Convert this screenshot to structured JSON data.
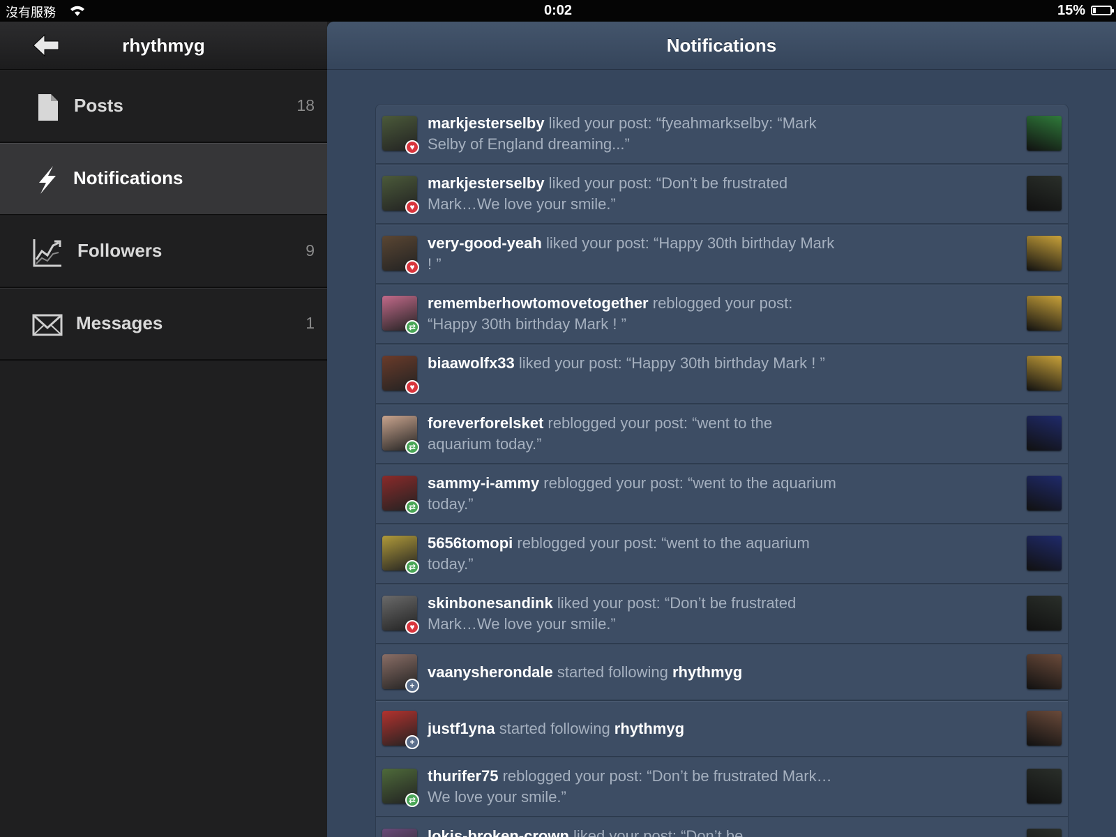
{
  "status_bar": {
    "carrier": "沒有服務",
    "time": "0:02",
    "battery": "15%"
  },
  "sidebar": {
    "title": "rhythmyg",
    "items": [
      {
        "label": "Posts",
        "count": "18",
        "icon": "document-icon"
      },
      {
        "label": "Notifications",
        "count": "",
        "icon": "lightning-icon"
      },
      {
        "label": "Followers",
        "count": "9",
        "icon": "chart-icon"
      },
      {
        "label": "Messages",
        "count": "1",
        "icon": "envelope-icon"
      }
    ]
  },
  "main": {
    "title": "Notifications",
    "notifications": [
      {
        "user": "markjesterselby",
        "action": " liked your post: “fyeahmarkselby: “Mark Selby of England dreaming...”",
        "target": "",
        "type": "like"
      },
      {
        "user": "markjesterselby",
        "action": " liked your post: “Don’t be frustrated Mark…We love your smile.”",
        "target": "",
        "type": "like"
      },
      {
        "user": "very-good-yeah",
        "action": " liked your post: “Happy 30th birthday Mark ! ”",
        "target": "",
        "type": "like"
      },
      {
        "user": "rememberhowtomovetogether",
        "action": " reblogged your post: “Happy 30th birthday Mark ! ”",
        "target": "",
        "type": "reblog"
      },
      {
        "user": "biaawolfx33",
        "action": " liked your post: “Happy 30th birthday Mark ! ”",
        "target": "",
        "type": "like"
      },
      {
        "user": "foreverforelsket",
        "action": " reblogged your post: “went to the aquarium today.”",
        "target": "",
        "type": "reblog"
      },
      {
        "user": "sammy-i-ammy",
        "action": " reblogged your post: “went to the aquarium today.”",
        "target": "",
        "type": "reblog"
      },
      {
        "user": "5656tomopi",
        "action": " reblogged your post: “went to the aquarium today.”",
        "target": "",
        "type": "reblog"
      },
      {
        "user": "skinbonesandink",
        "action": " liked your post: “Don’t be frustrated Mark…We love your smile.”",
        "target": "",
        "type": "like"
      },
      {
        "user": "vaanysherondale",
        "action": " started following ",
        "target": "rhythmyg",
        "type": "follow"
      },
      {
        "user": "justf1yna",
        "action": " started following ",
        "target": "rhythmyg",
        "type": "follow"
      },
      {
        "user": "thurifer75",
        "action": " reblogged your post: “Don’t be frustrated Mark…We love your smile.”",
        "target": "",
        "type": "reblog"
      },
      {
        "user": "lokis-broken-crown",
        "action": " liked your post: “Don’t be",
        "target": "",
        "type": "like"
      }
    ]
  },
  "colors": {
    "sidebar_bg": "#1f1f20",
    "main_bg": "#36465d",
    "row_bg": "#3d4d64",
    "like_badge": "#d9363e",
    "reblog_badge": "#49a556",
    "follow_badge": "#5b6f8c"
  }
}
